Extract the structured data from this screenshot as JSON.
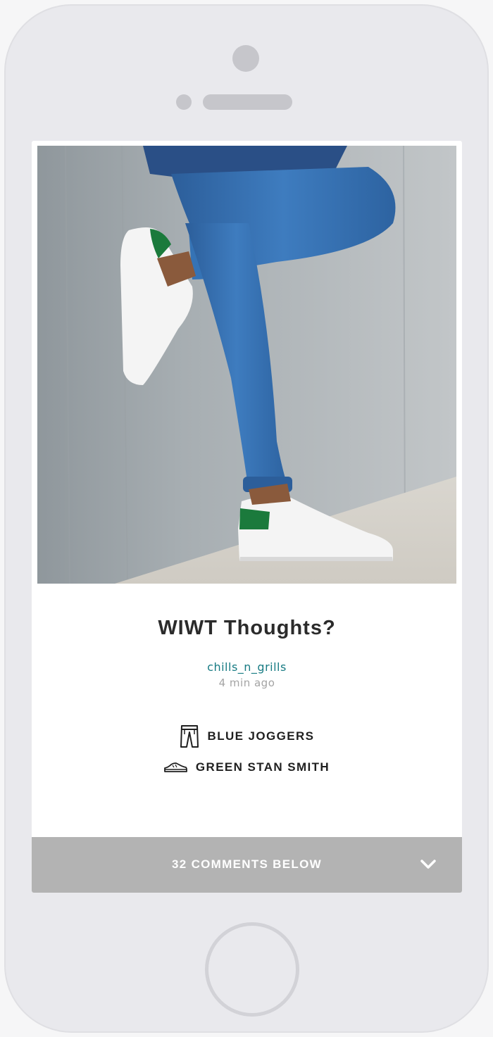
{
  "post": {
    "title": "WIWT Thoughts?",
    "author": "chills_n_grills",
    "timestamp": "4 min ago",
    "items": [
      {
        "icon": "joggers-icon",
        "label": "BLUE JOGGERS"
      },
      {
        "icon": "sneaker-icon",
        "label": "GREEN STAN SMITH"
      }
    ]
  },
  "comments": {
    "label": "32 COMMENTS BELOW",
    "icon": "chevron-down-icon"
  },
  "colors": {
    "author_link": "#177b83",
    "comments_bar": "#b3b3b3",
    "phone_body": "#e9e9ed"
  }
}
